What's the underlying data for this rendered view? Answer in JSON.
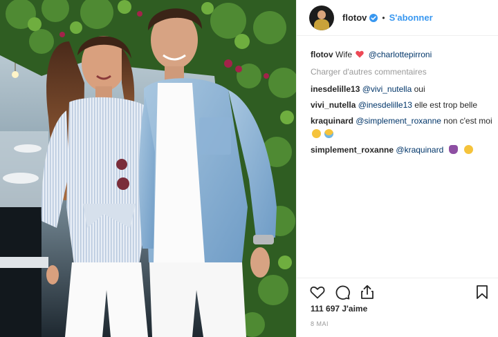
{
  "header": {
    "username": "flotov",
    "separator": "•",
    "follow_label": "S'abonner"
  },
  "caption": {
    "username": "flotov",
    "text": "Wife",
    "mention": "@charlottepirroni"
  },
  "load_more_label": "Charger d'autres commentaires",
  "comments": [
    {
      "username": "inesdelille13",
      "mention": "@vivi_nutella",
      "text": "oui"
    },
    {
      "username": "vivi_nutella",
      "mention": "@inesdelille13",
      "text": "elle est trop belle"
    },
    {
      "username": "kraquinard",
      "mention": "@simplement_roxanne",
      "text": "non c'est moi"
    },
    {
      "username": "simplement_roxanne",
      "mention": "@kraquinard",
      "text": ""
    }
  ],
  "likes": {
    "text": "111 697 J'aime"
  },
  "date": "8 MAI",
  "icons": {
    "like": "heart-outline-icon",
    "comment": "speech-bubble-icon",
    "share": "share-icon",
    "save": "bookmark-icon",
    "verified": "verified-badge-icon"
  },
  "colors": {
    "accent": "#3897f0",
    "verified": "#3897f0",
    "heart": "#ed4956",
    "mention": "#003569",
    "muted": "#999999",
    "text": "#262626",
    "divider": "#efefef"
  }
}
